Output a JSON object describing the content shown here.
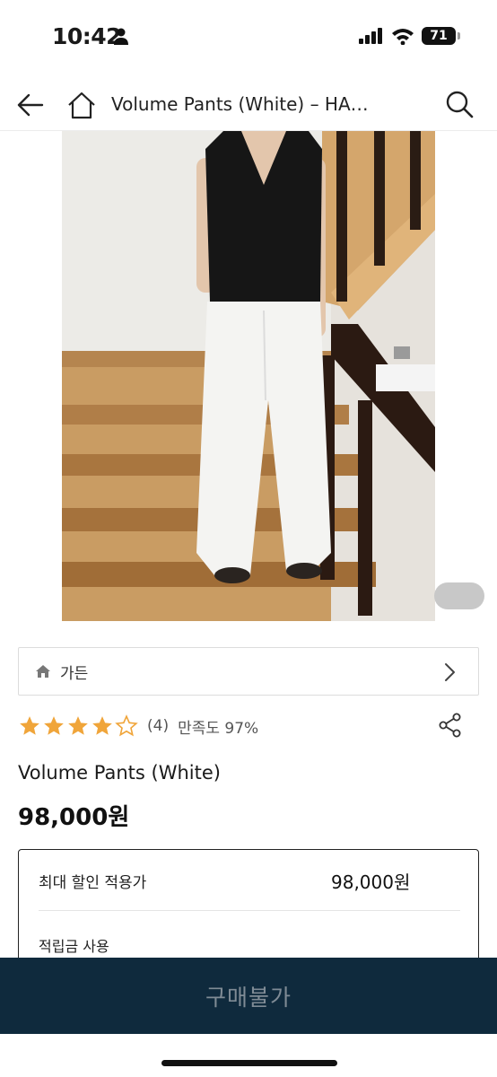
{
  "status": {
    "time": "10:42",
    "battery": "71",
    "icons": [
      "person-icon",
      "signal-icon",
      "wifi-icon",
      "battery-icon"
    ]
  },
  "nav": {
    "title": "Volume Pants (White) – HA…",
    "icons": [
      "back-arrow-icon",
      "home-icon",
      "search-icon"
    ]
  },
  "product": {
    "image_alt_icon": "product-photo",
    "category": "가든",
    "rating_stars": 4,
    "rating_max": 5,
    "review_count": "(4)",
    "satisfaction": "만족도 97%",
    "name": "Volume Pants (White)",
    "price": "98,000원"
  },
  "price_box": {
    "max_discount_label": "최대 할인 적용가",
    "max_discount_value": "98,000원",
    "points_label": "적립금 사용"
  },
  "bottom": {
    "buy_label": "구매불가"
  },
  "colors": {
    "star": "#f0a53a",
    "buy_bar": "#0f2a3d",
    "buy_text": "#7f8b95"
  }
}
